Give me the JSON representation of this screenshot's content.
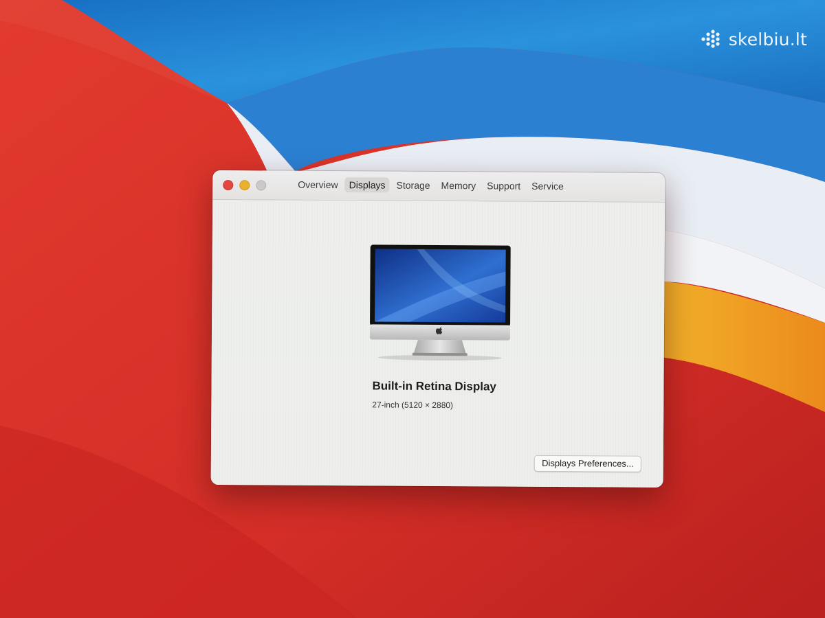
{
  "watermark": {
    "text": "skelbiu.lt",
    "icon": "skelbiu-logo-icon"
  },
  "window": {
    "traffic_lights": {
      "close_color": "#e2483f",
      "minimize_color": "#eab12c",
      "zoom_color": "#cbcac8"
    },
    "tabs": [
      {
        "label": "Overview",
        "active": false
      },
      {
        "label": "Displays",
        "active": true
      },
      {
        "label": "Storage",
        "active": false
      },
      {
        "label": "Memory",
        "active": false
      },
      {
        "label": "Support",
        "active": false
      },
      {
        "label": "Service",
        "active": false
      }
    ],
    "display": {
      "icon": "imac-icon",
      "name": "Built-in Retina Display",
      "spec": "27-inch (5120 × 2880)"
    },
    "preferences_button": "Displays Preferences..."
  },
  "colors": {
    "wallpaper_red": "#d8322b",
    "wallpaper_blue": "#1e7fcf",
    "wallpaper_orange": "#f0a41e",
    "window_bg": "#ecebe9"
  }
}
